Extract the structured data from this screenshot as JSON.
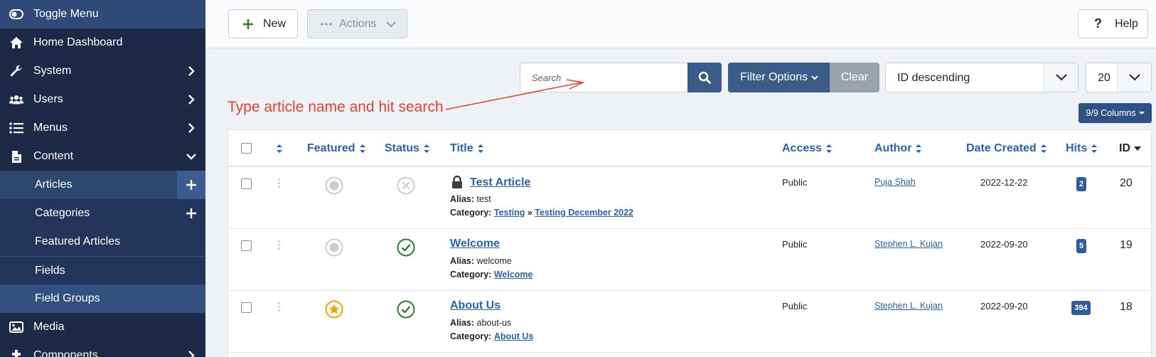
{
  "sidebar": {
    "toggle": "Toggle Menu",
    "home": "Home Dashboard",
    "system": "System",
    "users": "Users",
    "menus": "Menus",
    "content": "Content",
    "articles": "Articles",
    "categories": "Categories",
    "featured": "Featured Articles",
    "fields": "Fields",
    "field_groups": "Field Groups",
    "media": "Media",
    "components": "Components"
  },
  "toolbar": {
    "new": "New",
    "actions": "Actions",
    "help": "Help"
  },
  "filters": {
    "search_placeholder": "Search",
    "filter_options": "Filter Options",
    "clear": "Clear",
    "sort": "ID descending",
    "limit": "20",
    "columns": "9/9 Columns"
  },
  "annotation": "Type article name and hit search",
  "table": {
    "headers": {
      "featured": "Featured",
      "status": "Status",
      "title": "Title",
      "access": "Access",
      "author": "Author",
      "date_created": "Date Created",
      "hits": "Hits",
      "id": "ID"
    },
    "alias_label": "Alias:",
    "category_label": "Category:",
    "rows": [
      {
        "title": "Test Article",
        "alias": "test",
        "category_parent": "Testing",
        "category_sep": "»",
        "category": "Testing December 2022",
        "access": "Public",
        "author": "Puja Shah",
        "date": "2022-12-22",
        "hits": "2",
        "id": "20"
      },
      {
        "title": "Welcome",
        "alias": "welcome",
        "category": "Welcome",
        "access": "Public",
        "author": "Stephen L. Kujan",
        "date": "2022-09-20",
        "hits": "5",
        "id": "19"
      },
      {
        "title": "About Us",
        "alias": "about-us",
        "category": "About Us",
        "access": "Public",
        "author": "Stephen L. Kujan",
        "date": "2022-09-20",
        "hits": "394",
        "id": "18"
      }
    ]
  },
  "colors": {
    "sidebar_bg": "#1c2a47",
    "accent": "#3b5b89",
    "link": "#2a62b2",
    "annotation": "#e8402a",
    "published": "#2e7d32",
    "featured": "#f0a500"
  }
}
